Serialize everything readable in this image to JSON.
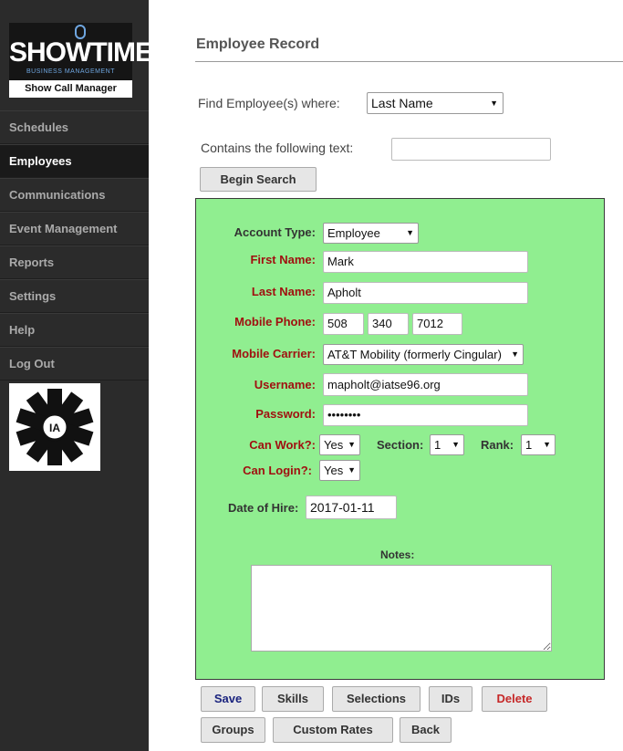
{
  "brand": {
    "title": "SHOWTIME",
    "subtitle": "BUSINESS MANAGEMENT",
    "tagline": "Show Call Manager"
  },
  "sidebar": {
    "items": [
      {
        "label": "Schedules"
      },
      {
        "label": "Employees"
      },
      {
        "label": "Communications"
      },
      {
        "label": "Event Management"
      },
      {
        "label": "Reports"
      },
      {
        "label": "Settings"
      },
      {
        "label": "Help"
      },
      {
        "label": "Log Out"
      }
    ],
    "active": "Employees",
    "union_logo_text": {
      "letters": [
        "I",
        "A",
        "T",
        "S",
        "E"
      ],
      "center": "IA"
    }
  },
  "page": {
    "title": "Employee Record"
  },
  "search": {
    "find_label": "Find Employee(s) where:",
    "field_value": "Last Name",
    "contains_label": "Contains the following text:",
    "contains_value": "",
    "begin_label": "Begin Search"
  },
  "form": {
    "account_type_label": "Account Type:",
    "account_type": "Employee",
    "first_name_label": "First Name:",
    "first_name": "Mark",
    "last_name_label": "Last Name:",
    "last_name": "Apholt",
    "mobile_phone_label": "Mobile Phone:",
    "phone_area": "508",
    "phone_prefix": "340",
    "phone_line": "7012",
    "mobile_carrier_label": "Mobile Carrier:",
    "mobile_carrier": "AT&T Mobility (formerly Cingular)",
    "username_label": "Username:",
    "username": "mapholt@iatse96.org",
    "password_label": "Password:",
    "password": "••••••••",
    "can_work_label": "Can Work?:",
    "can_work": "Yes",
    "section_label": "Section:",
    "section": "1",
    "rank_label": "Rank:",
    "rank": "1",
    "can_login_label": "Can Login?:",
    "can_login": "Yes",
    "hire_date_label": "Date of Hire:",
    "hire_date": "2017-01-11",
    "notes_label": "Notes:",
    "notes": ""
  },
  "actions": {
    "save": "Save",
    "skills": "Skills",
    "selections": "Selections",
    "ids": "IDs",
    "delete": "Delete",
    "groups": "Groups",
    "custom_rates": "Custom Rates",
    "back": "Back"
  },
  "colors": {
    "sidebar": "#2b2b2b",
    "panel": "#90ee90",
    "required_label": "#a01010",
    "save": "#1a237e",
    "delete": "#c62828"
  }
}
